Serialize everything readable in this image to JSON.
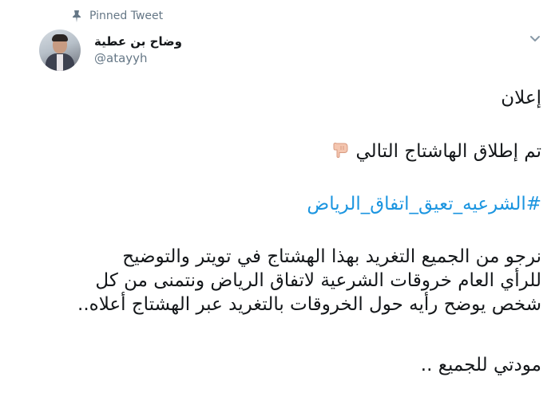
{
  "pinned": {
    "label": "Pinned Tweet",
    "icon": "pin-icon"
  },
  "author": {
    "name": "وضاح بن عطية",
    "handle": "@atayyh",
    "avatar_icon": "avatar"
  },
  "menu": {
    "icon": "chevron-down-icon"
  },
  "tweet": {
    "announcement": "إعلان",
    "launch_line": "تم إطلاق الهاشتاج التالي",
    "launch_emoji": "backhand-index-pointing-down-icon",
    "hashtag": "#الشرعيه_تعيق_اتفاق_الرياض",
    "body_lines": [
      "نرجو من الجميع التغريد بهذا الهشتاج في تويتر والتوضيح",
      "للرأي العام خروقات الشرعية لاتفاق الرياض ونتمنى من كل",
      "شخص يوضح رأيه حول الخروقات بالتغريد عبر الهشتاج أعلاه.."
    ],
    "closing": "مودتي للجميع .."
  },
  "colors": {
    "text": "#14171a",
    "secondary": "#657786",
    "link": "#1b95e0"
  }
}
